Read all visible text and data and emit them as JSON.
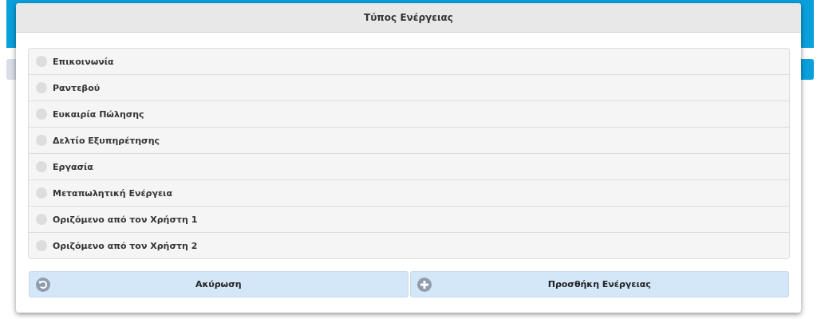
{
  "dialog": {
    "title": "Τύπος Ενέργειας",
    "options": [
      {
        "label": "Επικοινωνία",
        "selected": false
      },
      {
        "label": "Ραντεβού",
        "selected": false
      },
      {
        "label": "Ευκαιρία Πώλησης",
        "selected": false
      },
      {
        "label": "Δελτίο Εξυπηρέτησης",
        "selected": false
      },
      {
        "label": "Εργασία",
        "selected": false
      },
      {
        "label": "Μεταπωλητική Ενέργεια",
        "selected": false
      },
      {
        "label": "Οριζόμενο από τον Χρήστη 1",
        "selected": false
      },
      {
        "label": "Οριζόμενο από τον Χρήστη 2",
        "selected": false
      }
    ],
    "buttons": [
      {
        "label": "Ακύρωση",
        "kind": "undo"
      },
      {
        "label": "Προσθήκη Ενέργειας",
        "kind": "add"
      }
    ]
  }
}
